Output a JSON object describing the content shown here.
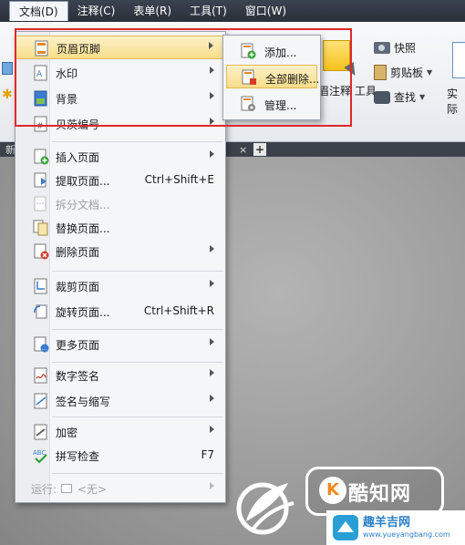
{
  "menubar": {
    "items": [
      {
        "label": "文档(D)",
        "active": true
      },
      {
        "label": "注释(C)"
      },
      {
        "label": "表单(R)"
      },
      {
        "label": "工具(T)"
      },
      {
        "label": "窗口(W)"
      }
    ]
  },
  "ribbon": {
    "snapshot": "快照",
    "clipboard": "剪贴板",
    "find": "查找",
    "actual": "实际",
    "comment_tools": "眉注释",
    "tool": "工具"
  },
  "tabbar": {
    "tab_label": "新建",
    "close": "×",
    "plus": "+"
  },
  "menu": {
    "items": [
      {
        "label": "页眉页脚",
        "arrow": true,
        "highlighted": true
      },
      {
        "label": "水印",
        "arrow": true
      },
      {
        "label": "背景",
        "arrow": true
      },
      {
        "label": "贝茨编号",
        "arrow": true
      },
      {
        "label": "插入页面",
        "arrow": true
      },
      {
        "label": "提取页面...",
        "shortcut": "Ctrl+Shift+E"
      },
      {
        "label": "拆分文档...",
        "disabled": true
      },
      {
        "label": "替换页面..."
      },
      {
        "label": "删除页面",
        "arrow": true
      },
      {
        "label": "裁剪页面",
        "arrow": true
      },
      {
        "label": "旋转页面...",
        "shortcut": "Ctrl+Shift+R"
      },
      {
        "label": "更多页面",
        "arrow": true
      },
      {
        "label": "数字签名",
        "arrow": true
      },
      {
        "label": "签名与缩写",
        "arrow": true
      },
      {
        "label": "加密",
        "arrow": true
      },
      {
        "label": "拼写检查",
        "shortcut": "F7"
      },
      {
        "label": "运行:",
        "value": "<无>",
        "arrow": true,
        "disabled": true
      }
    ]
  },
  "submenu": {
    "items": [
      {
        "label": "添加..."
      },
      {
        "label": "全部删除...",
        "highlighted": true
      },
      {
        "label": "管理..."
      }
    ]
  },
  "watermark": {
    "brand": "酷知网",
    "site_name": "趣羊吉网",
    "site_url": "www.yueyangbang.com"
  },
  "colors": {
    "highlight": "#f8dd8a",
    "annotation_box": "#e0282a",
    "menubar": "#2f3640"
  }
}
